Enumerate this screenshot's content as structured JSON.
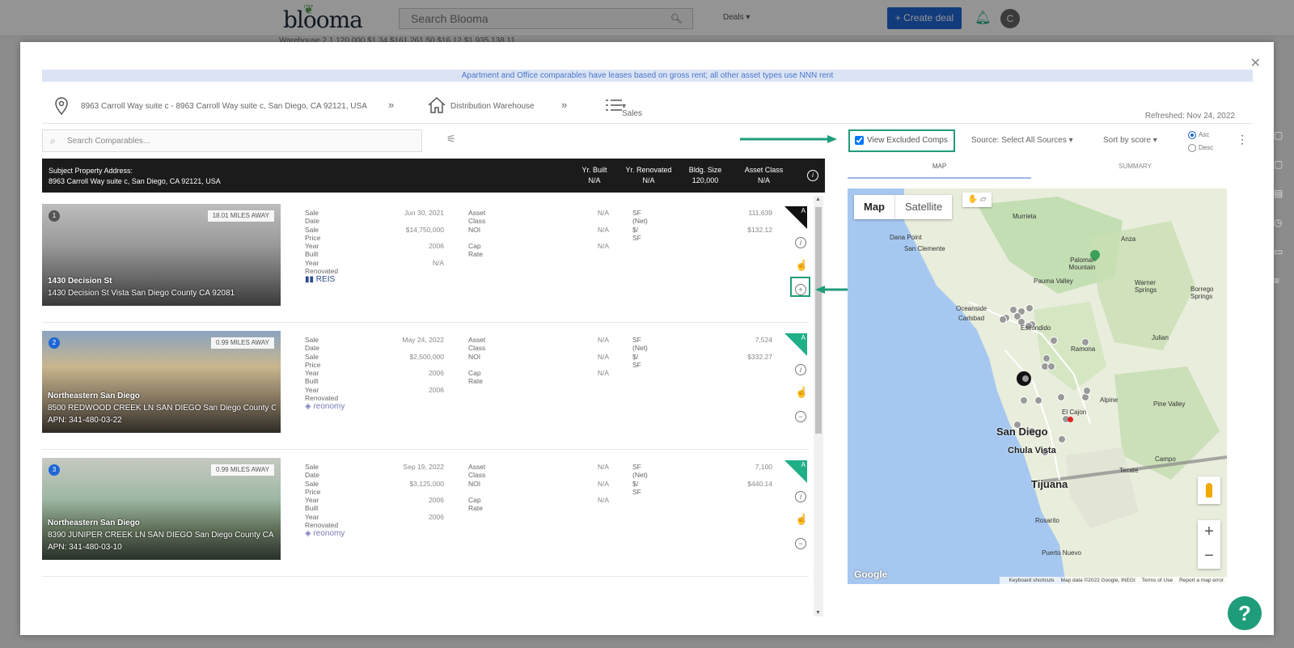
{
  "app": {
    "logo": "blooma",
    "search_placeholder": "Search Blooma",
    "deals_label": "Deals",
    "create_deal_label": "+ Create deal",
    "avatar_initial": "C",
    "background_row": "Warehouse    2    1    120,000    $1.34    $161,261.50    $16.12    $1,935,138.11"
  },
  "banner": "Apartment and Office comparables have leases based on gross rent; all other asset types use NNN rent",
  "breadcrumb": {
    "address": "8963 Carroll Way suite c - 8963 Carroll Way suite c, San Diego, CA 92121, USA",
    "separator": "»",
    "property_type": "Distribution Warehouse",
    "comp_type": "Sales"
  },
  "refreshed": "Refreshed: Nov 24, 2022",
  "toolbar": {
    "search_placeholder": "Search Comparables...",
    "view_excluded_label": "View Excluded Comps",
    "view_excluded_checked": true,
    "source_label": "Source: Select All Sources",
    "sort_label": "Sort by score",
    "asc_label": "Asc",
    "desc_label": "Desc"
  },
  "subject": {
    "label": "Subject Property Address:",
    "address": "8963 Carroll Way suite c, San Diego, CA 92121, USA",
    "columns": [
      {
        "label": "Yr. Built",
        "value": "N/A"
      },
      {
        "label": "Yr. Renovated",
        "value": "N/A"
      },
      {
        "label": "Bldg. Size",
        "value": "120,000"
      },
      {
        "label": "Asset Class",
        "value": "N/A"
      }
    ]
  },
  "field_labels": {
    "sale_date": "Sale Date",
    "sale_price": "Sale Price",
    "year_built": "Year Built",
    "year_renovated": "Year Renovated",
    "asset_class": "Asset Class",
    "noi": "NOI",
    "cap_rate": "Cap Rate",
    "sf_net": "SF (Net)",
    "price_sf": "$/ SF"
  },
  "comps": [
    {
      "num": "1",
      "distance": "18.01 MILES AWAY",
      "name": "1430 Decision St",
      "address": "1430 Decision St Vista San Diego County CA 92081",
      "apn": "",
      "sale_date": "Jun 30, 2021",
      "sale_price": "$14,750,000",
      "year_built": "2006",
      "year_renovated": "N/A",
      "asset_class": "N/A",
      "noi": "N/A",
      "cap_rate": "N/A",
      "sf_net": "111,639",
      "price_sf": "$132.12",
      "source": "REIS",
      "grade": "A",
      "excluded": true
    },
    {
      "num": "2",
      "distance": "0.99 MILES AWAY",
      "name": "Northeastern San Diego",
      "address": "8500 REDWOOD CREEK LN SAN DIEGO San Diego County C...",
      "apn": "APN: 341-480-03-22",
      "sale_date": "May 24, 2022",
      "sale_price": "$2,500,000",
      "year_built": "2006",
      "year_renovated": "2006",
      "asset_class": "N/A",
      "noi": "N/A",
      "cap_rate": "N/A",
      "sf_net": "7,524",
      "price_sf": "$332.27",
      "source": "reonomy",
      "grade": "A",
      "excluded": false
    },
    {
      "num": "3",
      "distance": "0.99 MILES AWAY",
      "name": "Northeastern San Diego",
      "address": "8390 JUNIPER CREEK LN SAN DIEGO San Diego County CA ...",
      "apn": "APN: 341-480-03-10",
      "sale_date": "Sep 19, 2022",
      "sale_price": "$3,125,000",
      "year_built": "2006",
      "year_renovated": "2006",
      "asset_class": "N/A",
      "noi": "N/A",
      "cap_rate": "N/A",
      "sf_net": "7,100",
      "price_sf": "$440.14",
      "source": "reonomy",
      "grade": "A",
      "excluded": false
    }
  ],
  "map": {
    "tab_map": "MAP",
    "tab_summary": "SUMMARY",
    "type_map": "Map",
    "type_satellite": "Satellite",
    "google": "Google",
    "attribution": [
      "Keyboard shortcuts",
      "Map data ©2022 Google, INEGI",
      "Terms of Use",
      "Report a map error"
    ],
    "places": [
      "Murrieta",
      "Anza",
      "Dana Point",
      "San Clemente",
      "Palomar Mountain",
      "Pauma Valley",
      "Warner Springs",
      "Borrego Springs",
      "Oceanside",
      "Carlsbad",
      "Escondido",
      "Ramona",
      "Julian",
      "Alpine",
      "Pine Valley",
      "El Cajon",
      "San Diego",
      "Chula Vista",
      "Campo",
      "Tecate",
      "Tijuana",
      "Rosarito",
      "Puerto Nuevo"
    ]
  },
  "colors": {
    "accent": "#1f9d7a",
    "primary": "#1f66d6",
    "banner_bg": "#dbe4f5",
    "subject_bg": "#1b1b1b"
  }
}
